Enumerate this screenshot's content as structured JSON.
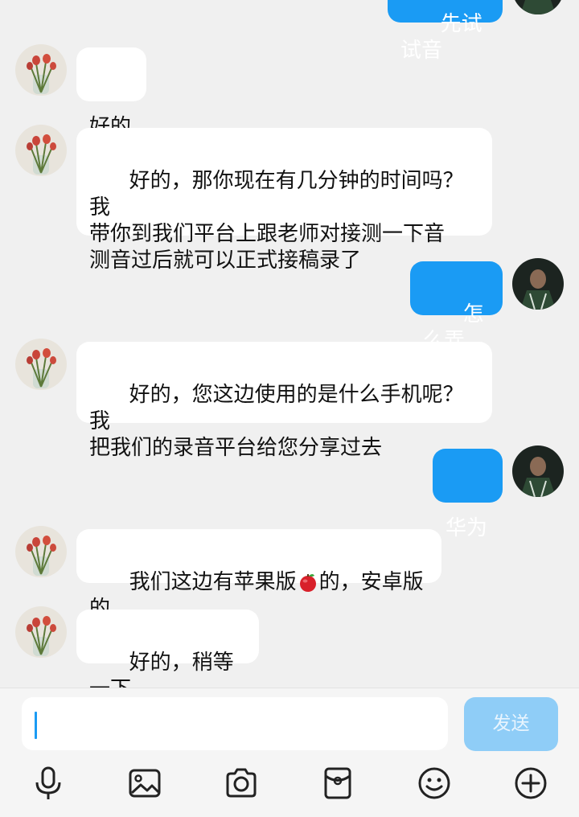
{
  "messages": [
    {
      "side": "right",
      "text": "先试试音"
    },
    {
      "side": "left",
      "text": "好的"
    },
    {
      "side": "left",
      "text": "好的，那你现在有几分钟的时间吗？我\n带你到我们平台上跟老师对接测一下音\n测音过后就可以正式接稿录了"
    },
    {
      "side": "right",
      "text": "怎么弄"
    },
    {
      "side": "left",
      "text": "好的，您这边使用的是什么手机呢？我\n把我们的录音平台给您分享过去"
    },
    {
      "side": "right",
      "text": "华为"
    },
    {
      "side": "left",
      "text_before": "我们这边有苹果版",
      "emoji": "apple-emoji",
      "text_after": "的，安卓版的"
    },
    {
      "side": "left",
      "text": "好的，稍等一下"
    }
  ],
  "composer": {
    "input_value": "",
    "send_label": "发送"
  },
  "toolbar": {
    "icons": [
      "microphone-icon",
      "image-icon",
      "camera-icon",
      "red-packet-icon",
      "emoji-icon",
      "plus-icon"
    ]
  },
  "colors": {
    "background": "#f0f0f0",
    "outgoing_bubble": "#1a9bf4",
    "incoming_bubble": "#ffffff",
    "send_button_disabled": "#8fcdf7"
  }
}
